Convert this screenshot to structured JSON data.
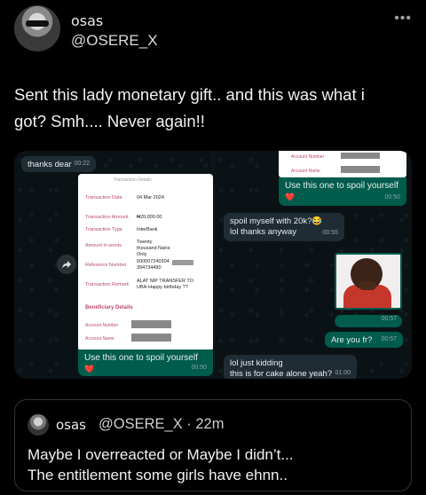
{
  "author": {
    "display_name": "osas",
    "handle": "@OSERE_X",
    "more_icon": "•••"
  },
  "tweet": {
    "text_line1": "Sent this lady monetary gift.. and this was what i",
    "text_line2": "got? Smh.... Never again!!"
  },
  "chat_left": {
    "thanks_bubble": "thanks dear",
    "thanks_time": "00:22",
    "receipt_header": "Transaction Details",
    "receipt_rows": [
      {
        "label": "Transaction Date",
        "value": "04 Mar 2024"
      },
      {
        "label": "Transaction Amount",
        "value": "₦20,000.00"
      },
      {
        "label": "Transaction Type",
        "value": "InterBank"
      },
      {
        "label": "Amount in words",
        "value": "Twenty thousand Naira Only"
      },
      {
        "label": "Reference Number",
        "value": "000007240304 394734490"
      },
      {
        "label": "Transaction Remark",
        "value": "ALAT NIP TRANSFER TO UBA-Happy birthday ??"
      }
    ],
    "beneficiary_title": "Beneficiary Details",
    "account_number_label": "Account Number",
    "account_name_label": "Account Name",
    "caption": "Use this one to spoil yourself",
    "heart": "❤️",
    "caption_time": "00:50"
  },
  "chat_right": {
    "account_number_label": "Account Number",
    "account_name_label": "Account Name",
    "caption": "Use this one to spoil yourself",
    "heart": "❤️",
    "caption_time": "00:50",
    "reply1_line1": "spoil myself with 20k?😂",
    "reply1_line2": "lol thanks anyway",
    "reply1_time": "00:55",
    "photo_time": "00:57",
    "question": "Are you fr?",
    "question_time": "00:57",
    "reply2_line1": "lol just kidding",
    "reply2_line2": "this is for cake alone yeah?",
    "reply2_time": "01:00"
  },
  "quote": {
    "display_name": "osas",
    "handle_time": "@OSERE_X · 22m",
    "text_line1": "Maybe I overreacted or Maybe I didn’t...",
    "text_line2": "The entitlement some girls have ehnn.."
  },
  "colors": {
    "background": "#000000",
    "incoming_bubble": "#202c33",
    "outgoing_bubble": "#005c4b"
  }
}
